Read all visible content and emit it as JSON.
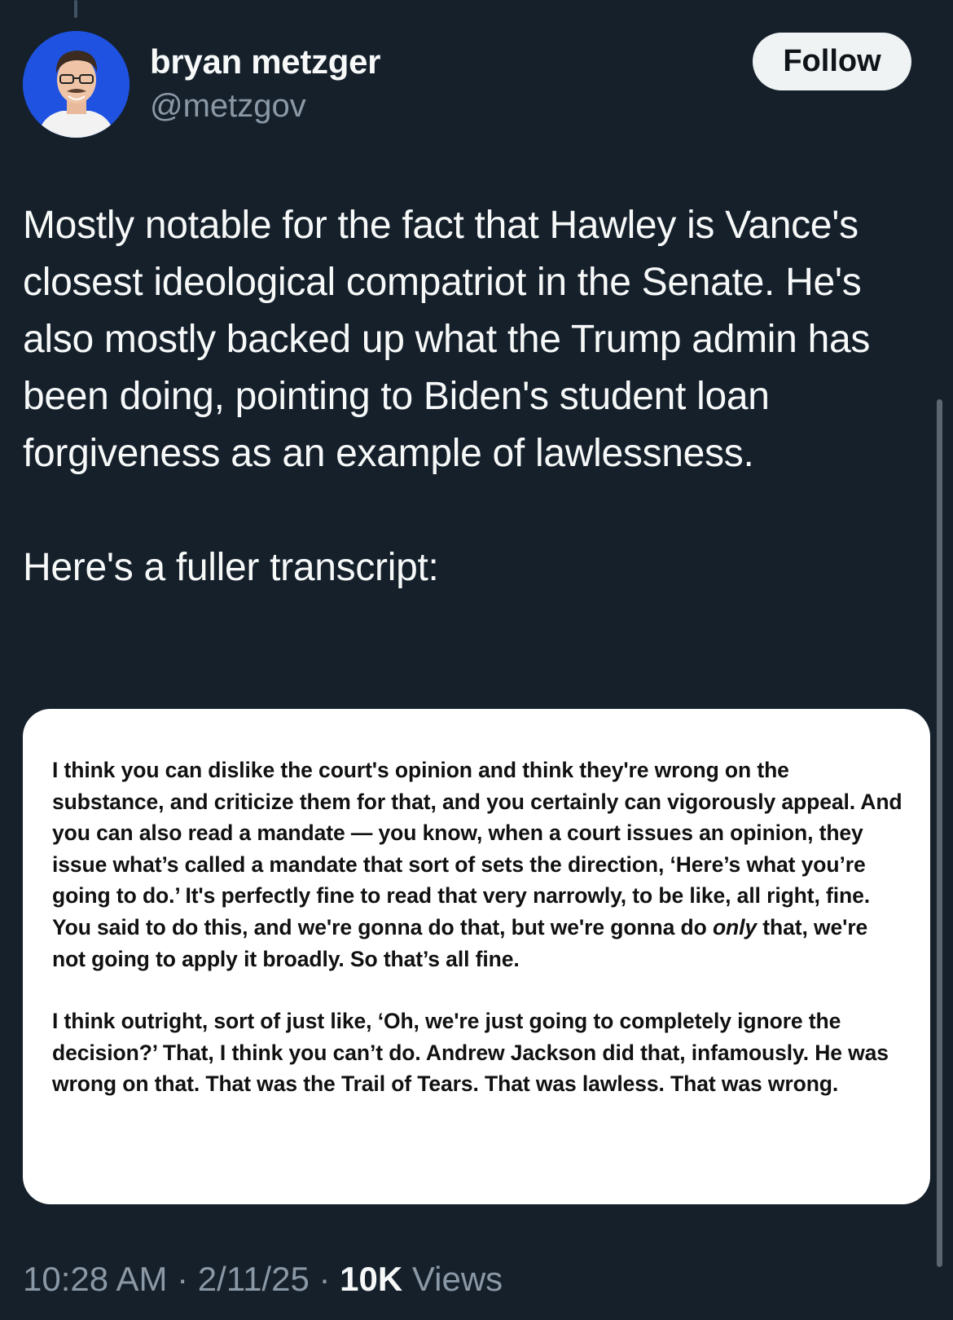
{
  "author": {
    "display_name": "bryan metzger",
    "handle": "@metzgov",
    "avatar_icon": "profile-photo"
  },
  "follow_button": {
    "label": "Follow"
  },
  "tweet": {
    "paragraphs": [
      "Mostly notable for the fact that Hawley is Vance's closest ideological compatriot in the Senate. He's also mostly backed up what the Trump admin has been doing, pointing to Biden's student loan forgiveness as an example of lawlessness.",
      "Here's a fuller transcript:"
    ]
  },
  "media": {
    "paragraph_1": {
      "before": "I think you can dislike the court's opinion and think they're wrong on the substance, and criticize them for that, and you certainly can vigorously appeal. And you can also read a mandate — you know, when a court issues an opinion, they issue what’s called a mandate that sort of sets the direction, ‘Here’s what you’re going to do.’ It's perfectly fine to read that very narrowly, to be like, all right, fine. You said to do this, and we're gonna do that, but we're gonna do ",
      "emphasis": "only",
      "after": " that, we're not going to apply it broadly. So that’s all fine."
    },
    "paragraph_2": "I think outright, sort of just like, ‘Oh, we're just going to completely ignore the decision?’ That, I think you can’t do. Andrew Jackson did that, infamously. He was wrong on that. That was the Trail of Tears. That was lawless. That was wrong."
  },
  "meta": {
    "time": "10:28 AM",
    "separator": " · ",
    "date": "2/11/25",
    "views_count": "10K",
    "views_label": " Views"
  },
  "colors": {
    "background": "#15202b",
    "text_primary": "#f7f9f9",
    "text_secondary": "#8b98a5",
    "follow_bg": "#eff3f4",
    "avatar_bg": "#1f52e0"
  }
}
